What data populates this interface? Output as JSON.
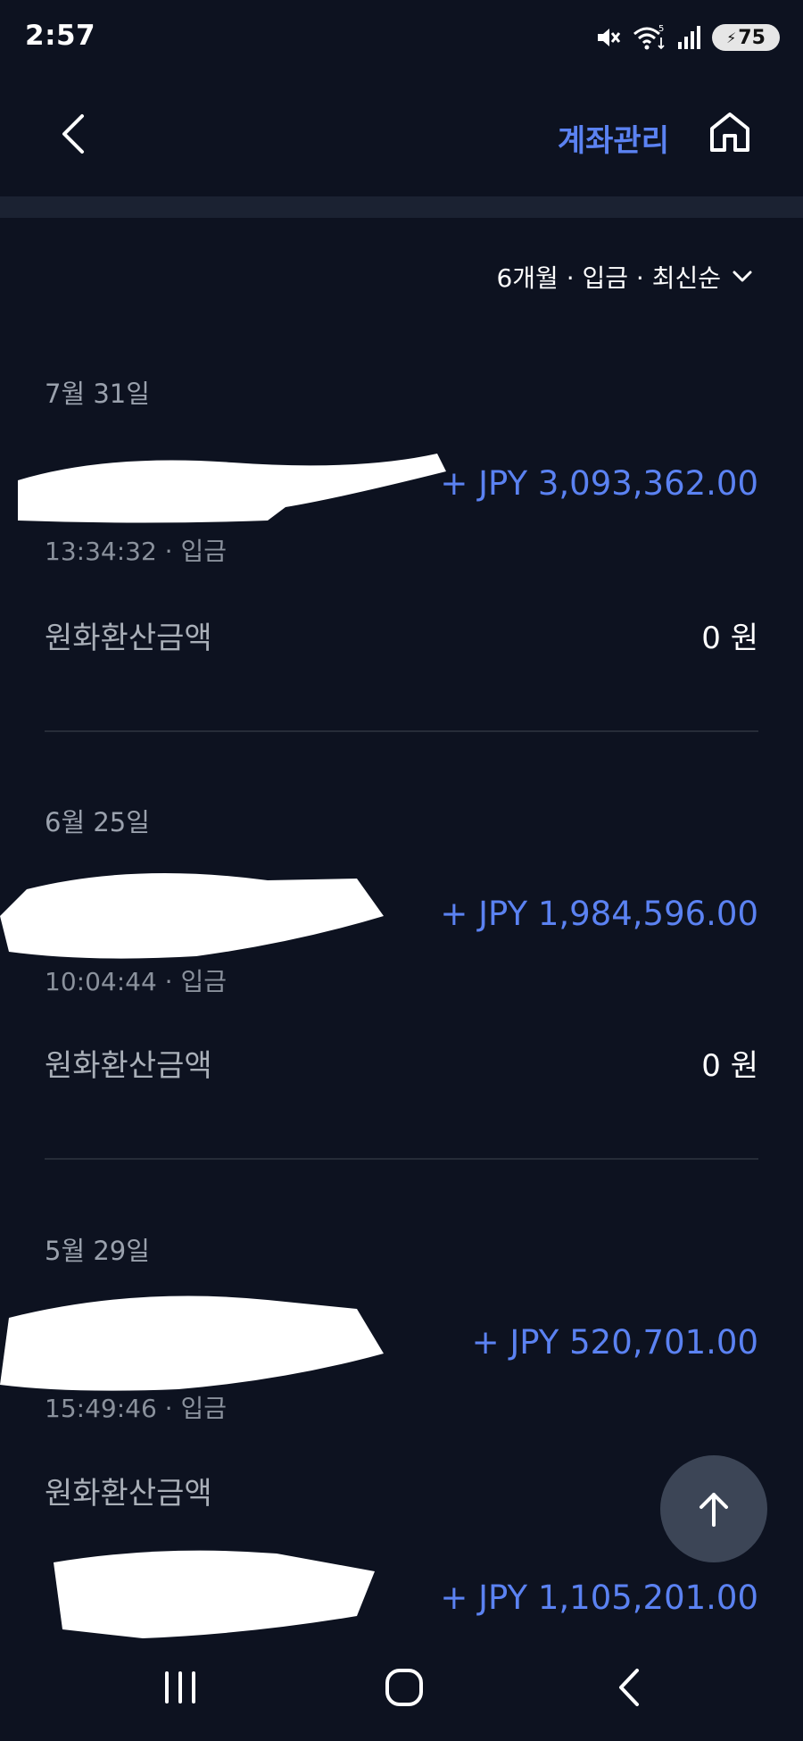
{
  "status_bar": {
    "time": "2:57",
    "battery_level": "75",
    "icons": [
      "mute-icon",
      "wifi-icon",
      "signal-icon",
      "battery-icon"
    ],
    "wifi_badge": "5"
  },
  "header": {
    "account_manage_label": "계좌관리",
    "icons": [
      "back-icon",
      "home-icon"
    ]
  },
  "filter": {
    "label": "6개월 · 입금 · 최신순",
    "icon": "chevron-down-icon"
  },
  "transactions": [
    {
      "date": "7월 31일",
      "amount": "+ JPY 3,093,362.00",
      "subline": "13:34:32 · 입금",
      "krw_label": "원화환산금액",
      "krw_value": "0 원"
    },
    {
      "date": "6월 25일",
      "amount": "+ JPY 1,984,596.00",
      "subline": "10:04:44 · 입금",
      "krw_label": "원화환산금액",
      "krw_value": "0 원"
    },
    {
      "date": "5월 29일",
      "amount": "+ JPY 520,701.00",
      "subline": "15:49:46 · 입금",
      "krw_label": "원화환산금액",
      "krw_value": ""
    },
    {
      "amount": "+ JPY 1,105,201.00"
    }
  ],
  "colors": {
    "background": "#0d1220",
    "accent": "#5b82f2",
    "muted_text": "#9aa1ad",
    "fab": "#3c4556"
  },
  "fab_icon": "arrow-up-icon",
  "nav_icons": [
    "recents-icon",
    "home-nav-icon",
    "back-nav-icon"
  ]
}
